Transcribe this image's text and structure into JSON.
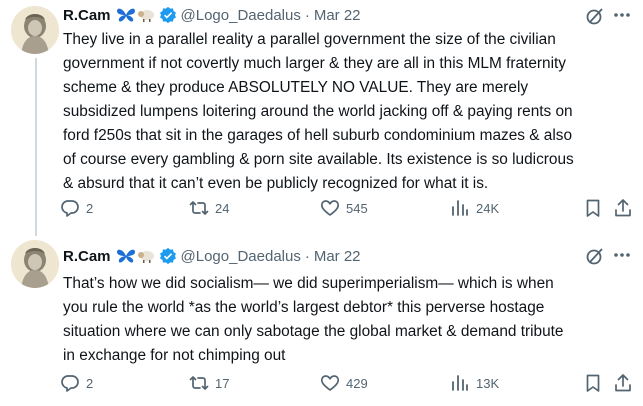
{
  "tweets": [
    {
      "author_name": "R.Cam",
      "handle": "@Logo_Daedalus",
      "separator": "·",
      "date": "Mar 22",
      "text": "They live in a parallel reality a parallel government the size of the civilian\ngovernment if not covertly much larger & they are all in this MLM fraternity\nscheme & they produce ABSOLUTELY NO VALUE. They are merely\nsubsidized lumpens loitering around the world jacking off & paying rents on\nford f250s that sit in the garages of hell suburb condominium mazes & also\nof course every gambling & porn site available. Its existence is so ludicrous\n& absurd that it can’t even be publicly recognized for what it is.",
      "replies": "2",
      "retweets": "24",
      "likes": "545",
      "views": "24K"
    },
    {
      "author_name": "R.Cam",
      "handle": "@Logo_Daedalus",
      "separator": "·",
      "date": "Mar 22",
      "text": "That’s how we did socialism— we did superimperialism— which is when\nyou rule the world *as the world’s largest debtor* this perverse hostage\nsituation where we can only sabotage the global market & demand tribute\nin exchange for not chimping out",
      "replies": "2",
      "retweets": "17",
      "likes": "429",
      "views": "13K"
    }
  ],
  "colors": {
    "text": "#0f1419",
    "secondary": "#536471",
    "verified": "#1d9bf0",
    "butterfly": "#1d6fd6",
    "thread_line": "#cfd9de"
  },
  "icons": [
    "avatar-statue",
    "butterfly-emoji",
    "sheep-emoji",
    "verified-badge",
    "grok-icon",
    "more-icon",
    "reply-icon",
    "retweet-icon",
    "like-icon",
    "views-icon",
    "bookmark-icon",
    "share-icon"
  ]
}
